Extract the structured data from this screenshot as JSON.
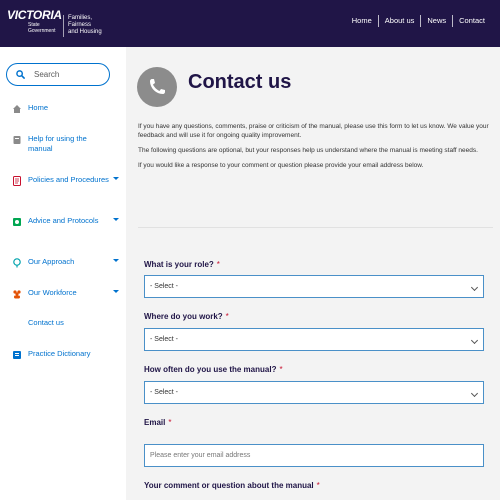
{
  "header": {
    "logo_text": "VICTORIA",
    "logo_sub": [
      "State",
      "Government"
    ],
    "department": [
      "Families,",
      "Fairness",
      "and Housing"
    ],
    "nav": [
      "Home",
      "About us",
      "News",
      "Contact"
    ]
  },
  "sidebar": {
    "search_placeholder": "Search",
    "items": [
      {
        "label": "Home",
        "icon": "home-icon",
        "expandable": false
      },
      {
        "label": "Help for using the manual",
        "icon": "book-icon",
        "expandable": false
      },
      {
        "label": "Policies and Procedures",
        "icon": "document-icon",
        "expandable": true
      },
      {
        "label": "Advice and Protocols",
        "icon": "shield-icon",
        "expandable": true
      },
      {
        "label": "Our Approach",
        "icon": "lightbulb-icon",
        "expandable": true
      },
      {
        "label": "Our Workforce",
        "icon": "people-icon",
        "expandable": true
      },
      {
        "label": "Contact us",
        "icon": "",
        "expandable": false
      },
      {
        "label": "Practice Dictionary",
        "icon": "dictionary-icon",
        "expandable": false
      }
    ]
  },
  "main": {
    "title": "Contact us",
    "intro": [
      "If you have any questions, comments, praise or criticism of the manual, please use this form to let us know. We value your feedback and will use it for ongoing quality improvement.",
      "The following questions are optional, but your responses help us understand where the manual is meeting staff needs.",
      "If you would like a response to your comment or question please provide your email address below."
    ],
    "form": {
      "role_label": "What is your role?",
      "role_value": "- Select -",
      "work_label": "Where do you work?",
      "work_value": "- Select -",
      "usage_label": "How often do you use the manual?",
      "usage_value": "- Select -",
      "email_label": "Email",
      "email_placeholder": "Please enter your email address",
      "comment_label": "Your comment or question about the manual",
      "required_marker": "*"
    }
  },
  "colors": {
    "header_bg": "#201547",
    "accent": "#0072ce",
    "required": "#c8102e",
    "main_bg": "#f3f3f3"
  }
}
